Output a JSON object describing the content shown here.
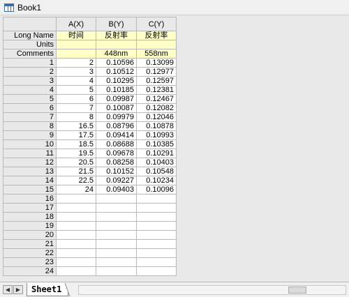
{
  "window": {
    "title": "Book1",
    "icon": "book-icon"
  },
  "columns": {
    "a": "A(X)",
    "b": "B(Y)",
    "c": "C(Y)"
  },
  "meta_rows": {
    "long_name": {
      "label": "Long Name",
      "a": "时间",
      "b": "反射率",
      "c": "反射率"
    },
    "units": {
      "label": "Units",
      "a": "",
      "b": "",
      "c": ""
    },
    "comments": {
      "label": "Comments",
      "a": "",
      "b": "448nm",
      "c": "558nm"
    }
  },
  "rows": [
    {
      "n": "1",
      "a": "2",
      "b": "0.10596",
      "c": "0.13099"
    },
    {
      "n": "2",
      "a": "3",
      "b": "0.10512",
      "c": "0.12977"
    },
    {
      "n": "3",
      "a": "4",
      "b": "0.10295",
      "c": "0.12597"
    },
    {
      "n": "4",
      "a": "5",
      "b": "0.10185",
      "c": "0.12381"
    },
    {
      "n": "5",
      "a": "6",
      "b": "0.09987",
      "c": "0.12467"
    },
    {
      "n": "6",
      "a": "7",
      "b": "0.10087",
      "c": "0.12082"
    },
    {
      "n": "7",
      "a": "8",
      "b": "0.09979",
      "c": "0.12046"
    },
    {
      "n": "8",
      "a": "16.5",
      "b": "0.08796",
      "c": "0.10878"
    },
    {
      "n": "9",
      "a": "17.5",
      "b": "0.09414",
      "c": "0.10993"
    },
    {
      "n": "10",
      "a": "18.5",
      "b": "0.08688",
      "c": "0.10385"
    },
    {
      "n": "11",
      "a": "19.5",
      "b": "0.09678",
      "c": "0.10291"
    },
    {
      "n": "12",
      "a": "20.5",
      "b": "0.08258",
      "c": "0.10403"
    },
    {
      "n": "13",
      "a": "21.5",
      "b": "0.10152",
      "c": "0.10548"
    },
    {
      "n": "14",
      "a": "22.5",
      "b": "0.09227",
      "c": "0.10234"
    },
    {
      "n": "15",
      "a": "24",
      "b": "0.09403",
      "c": "0.10096"
    },
    {
      "n": "16",
      "a": "",
      "b": "",
      "c": ""
    },
    {
      "n": "17",
      "a": "",
      "b": "",
      "c": ""
    },
    {
      "n": "18",
      "a": "",
      "b": "",
      "c": ""
    },
    {
      "n": "19",
      "a": "",
      "b": "",
      "c": ""
    },
    {
      "n": "20",
      "a": "",
      "b": "",
      "c": ""
    },
    {
      "n": "21",
      "a": "",
      "b": "",
      "c": ""
    },
    {
      "n": "22",
      "a": "",
      "b": "",
      "c": ""
    },
    {
      "n": "23",
      "a": "",
      "b": "",
      "c": ""
    },
    {
      "n": "24",
      "a": "",
      "b": "",
      "c": ""
    }
  ],
  "sheet_tabs": [
    "Sheet1"
  ],
  "colors": {
    "meta_bg": "#ffffc8",
    "header_bg": "#e8e8e8",
    "workspace_bg": "#e9e9e9"
  }
}
